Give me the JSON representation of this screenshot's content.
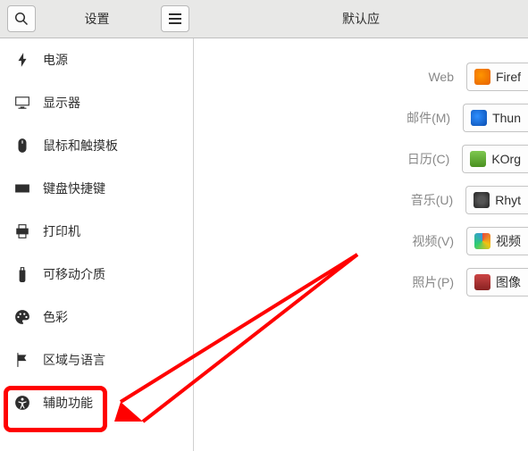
{
  "header": {
    "title": "设置",
    "title_right": "默认应"
  },
  "sidebar": {
    "items": [
      {
        "label": "电源"
      },
      {
        "label": "显示器"
      },
      {
        "label": "鼠标和触摸板"
      },
      {
        "label": "键盘快捷键"
      },
      {
        "label": "打印机"
      },
      {
        "label": "可移动介质"
      },
      {
        "label": "色彩"
      },
      {
        "label": "区域与语言"
      },
      {
        "label": "辅助功能"
      }
    ]
  },
  "main": {
    "rows": [
      {
        "label": "Web",
        "app": "Firef"
      },
      {
        "label": "邮件(M)",
        "app": "Thun"
      },
      {
        "label": "日历(C)",
        "app": "KOrg"
      },
      {
        "label": "音乐(U)",
        "app": "Rhyt"
      },
      {
        "label": "视频(V)",
        "app": "视频"
      },
      {
        "label": "照片(P)",
        "app": "图像"
      }
    ]
  },
  "colors": {
    "highlight": "#ff0000"
  }
}
